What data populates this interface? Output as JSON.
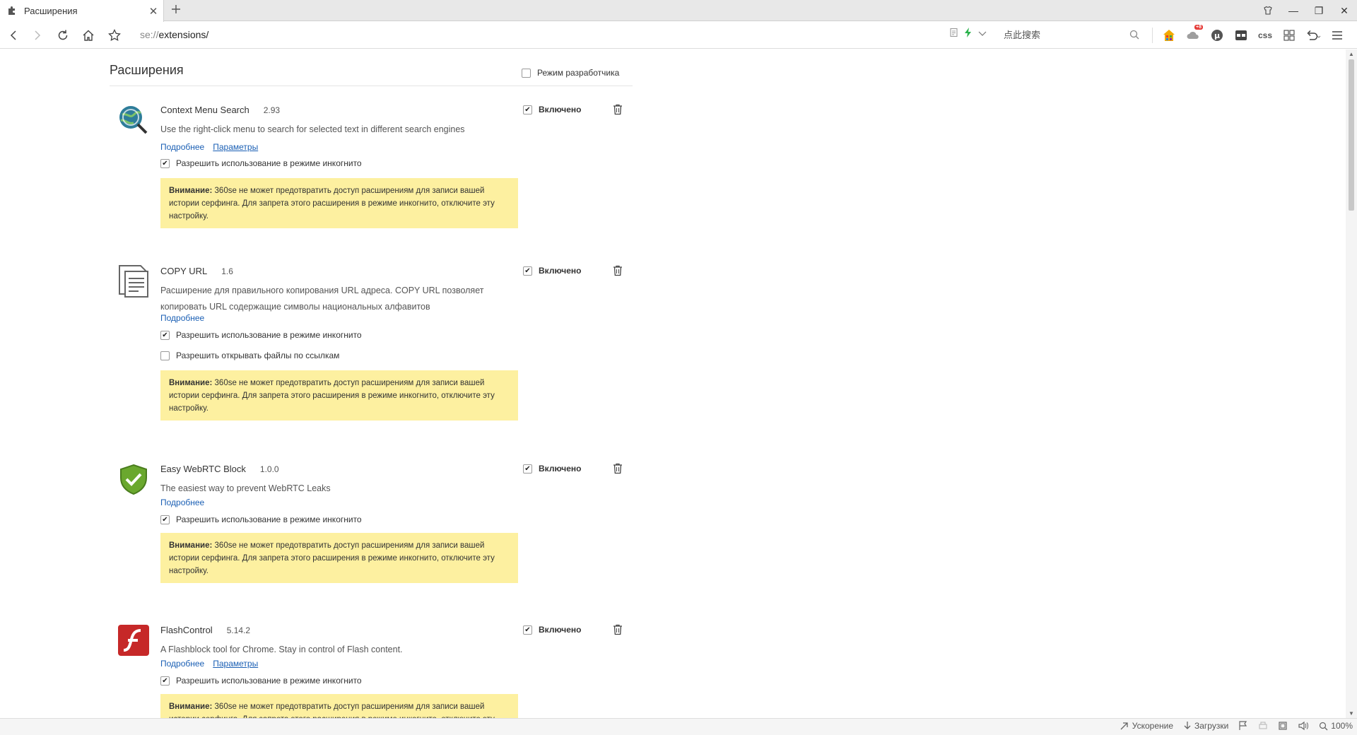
{
  "tab": {
    "title": "Расширения",
    "close": "✕"
  },
  "window": {
    "minimize": "—",
    "maximize": "❐",
    "close": "✕"
  },
  "address": {
    "scheme": "se://",
    "path": "extensions/"
  },
  "search": {
    "placeholder": "点此搜索"
  },
  "toolbar_ext": {
    "css_label": "css",
    "badge_count": "+8"
  },
  "page": {
    "title": "Расширения",
    "dev_mode_label": "Режим разработчика"
  },
  "labels": {
    "enabled": "Включено",
    "details": "Подробнее",
    "options": "Параметры",
    "allow_incognito": "Разрешить использование в режиме инкогнито",
    "allow_file_urls": "Разрешить открывать файлы по ссылкам",
    "warning_bold": "Внимание:",
    "warning_text": " 360se не может предотвратить доступ расширениям для записи вашей истории серфинга. Для запрета этого расширения в режиме инкогнито, отключите эту настройку."
  },
  "extensions": [
    {
      "name": "Context Menu Search",
      "version": "2.93",
      "description": "Use the right-click menu to search for selected text in different search engines",
      "enabled": true,
      "incognito": true
    },
    {
      "name": "COPY URL",
      "version": "1.6",
      "description": "Расширение для правильного копирования URL адреса. COPY URL позволяет копировать URL содержащие символы национальных алфавитов",
      "enabled": true,
      "incognito": true,
      "file_urls": false
    },
    {
      "name": "Easy WebRTC Block",
      "version": "1.0.0",
      "description": "The easiest way to prevent WebRTC Leaks",
      "enabled": true,
      "incognito": true
    },
    {
      "name": "FlashControl",
      "version": "5.14.2",
      "description": "A Flashblock tool for Chrome. Stay in control of Flash content.",
      "enabled": true,
      "incognito": true
    }
  ],
  "status": {
    "acceleration": "Ускорение",
    "downloads": "Загрузки",
    "zoom": "100%"
  },
  "colors": {
    "warning_bg": "#fdf0a0",
    "link": "#1a5fb4",
    "accel_green": "#2bb24c"
  }
}
